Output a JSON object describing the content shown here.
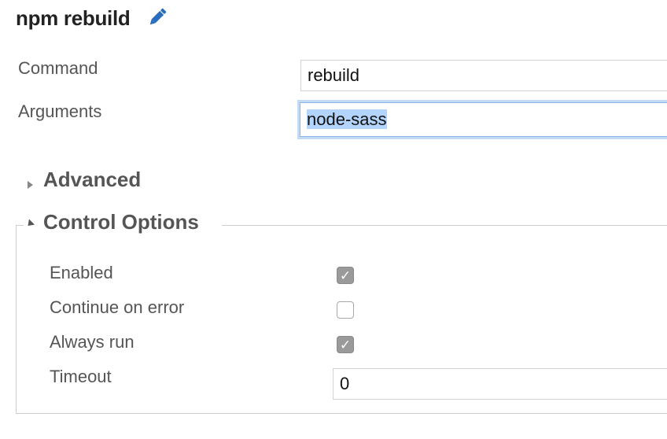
{
  "task": {
    "title": "npm rebuild",
    "edit_icon": "pencil-icon"
  },
  "fields": {
    "command": {
      "label": "Command",
      "value": "rebuild"
    },
    "arguments": {
      "label": "Arguments",
      "value": "node-sass"
    }
  },
  "sections": {
    "advanced": {
      "label": "Advanced",
      "expanded": false
    },
    "control_options": {
      "label": "Control Options",
      "expanded": true,
      "enabled": {
        "label": "Enabled",
        "checked": true,
        "check_glyph": "✓"
      },
      "continue_on_error": {
        "label": "Continue on error",
        "checked": false,
        "check_glyph": ""
      },
      "always_run": {
        "label": "Always run",
        "checked": true,
        "check_glyph": "✓"
      },
      "timeout": {
        "label": "Timeout",
        "value": "0"
      }
    }
  },
  "colors": {
    "focus_ring": "#c3daf5",
    "selection": "#b3d4fd",
    "pencil": "#2a6ebb",
    "checkbox_checked": "#9a9a9a"
  }
}
